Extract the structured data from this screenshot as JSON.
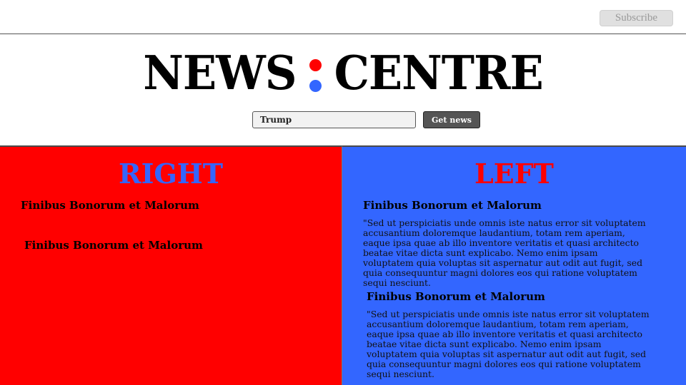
{
  "header": {
    "subscribe_label": "Subscribe"
  },
  "logo": {
    "left_word": "NEWS",
    "right_word": "CENTRE",
    "colon_top_color": "#ff0000",
    "colon_bottom_color": "#3366ff"
  },
  "search": {
    "value": "Trump",
    "button_label": "Get news"
  },
  "colors": {
    "right_panel_bg": "#ff0000",
    "left_panel_bg": "#3366ff"
  },
  "right_panel": {
    "title": "RIGHT",
    "title_color": "#3366ff",
    "articles": [
      {
        "title": "Finibus Bonorum et Malorum"
      },
      {
        "title": "Finibus Bonorum et Malorum"
      }
    ]
  },
  "left_panel": {
    "title": "LEFT",
    "title_color": "#ff0000",
    "articles": [
      {
        "title": "Finibus Bonorum et Malorum",
        "body": "\"Sed ut perspiciatis unde omnis iste natus error sit voluptatem accusantium doloremque laudantium, totam rem aperiam, eaque ipsa quae ab illo inventore veritatis et quasi architecto beatae vitae dicta sunt explicabo. Nemo enim ipsam voluptatem quia voluptas sit aspernatur aut odit aut fugit, sed quia consequuntur magni dolores eos qui ratione voluptatem sequi nesciunt."
      },
      {
        "title": "Finibus Bonorum et Malorum",
        "body": "\"Sed ut perspiciatis unde omnis iste natus error sit voluptatem accusantium doloremque laudantium, totam rem aperiam, eaque ipsa quae ab illo inventore veritatis et quasi architecto beatae vitae dicta sunt explicabo. Nemo enim ipsam voluptatem quia voluptas sit aspernatur aut odit aut fugit, sed quia consequuntur magni dolores eos qui ratione voluptatem sequi nesciunt."
      }
    ]
  }
}
